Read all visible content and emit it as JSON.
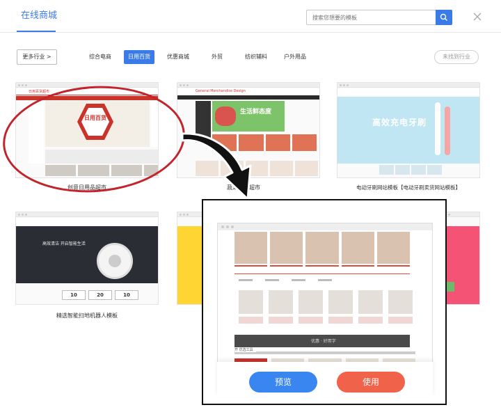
{
  "header": {
    "active_tab": "在线商城",
    "search_placeholder": "搜索您想要的模板"
  },
  "categories": {
    "more_label": "更多行业 >",
    "items": [
      {
        "label": "综合电商",
        "active": false
      },
      {
        "label": "日用百货",
        "active": true
      },
      {
        "label": "优惠商城",
        "active": false
      },
      {
        "label": "外贸",
        "active": false
      },
      {
        "label": "纺织辅料",
        "active": false
      },
      {
        "label": "户外用品",
        "active": false
      }
    ],
    "missing_label": "未找到行业"
  },
  "templates": [
    {
      "name": "创意日用品超市",
      "hero_text": "日用百货",
      "site_name": "日用百货超市"
    },
    {
      "name": "蔬菜生鲜超市",
      "hero_text": "生活鲜态度",
      "site_name": "General Merchandise Design"
    },
    {
      "name": "电动牙刷网站模板【电动牙刷卖货网站模板】",
      "hero_text": "高效充电牙刷"
    },
    {
      "name": "精选智能扫地机器人模板",
      "hero_text": "高效清洁 开启智能生活",
      "stats": [
        "10",
        "20",
        "10"
      ]
    }
  ],
  "preview": {
    "preview_label": "预览",
    "use_label": "使用",
    "banner_text": "优惠 · 好用字",
    "section_label": "开 优选工具"
  },
  "colors": {
    "accent": "#3a7be8",
    "annotation": "#c2242c",
    "preview_button": "#3a86f0",
    "use_button": "#f0624a"
  }
}
